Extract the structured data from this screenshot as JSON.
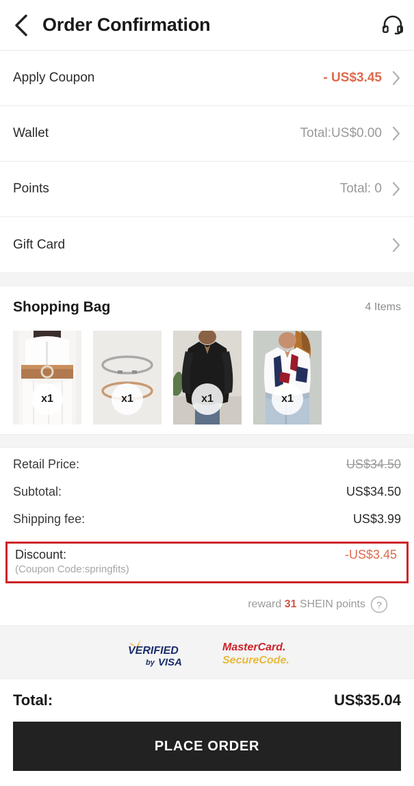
{
  "header": {
    "title": "Order Confirmation",
    "back_icon": "chevron-left-icon",
    "support_icon": "headset-icon"
  },
  "options": [
    {
      "label": "Apply Coupon",
      "value": "- US$3.45",
      "accent": true,
      "chevron": "chevron-right-icon"
    },
    {
      "label": "Wallet",
      "value": "Total:US$0.00",
      "accent": false,
      "chevron": "chevron-right-icon"
    },
    {
      "label": "Points",
      "value": "Total: 0",
      "accent": false,
      "chevron": "chevron-right-icon"
    },
    {
      "label": "Gift Card",
      "value": "",
      "accent": false,
      "chevron": "chevron-right-icon"
    }
  ],
  "shopping_bag": {
    "title": "Shopping Bag",
    "item_count": "4 Items",
    "items": [
      {
        "qty": "x1",
        "alt": "white-shirt-dress-with-brown-belt"
      },
      {
        "qty": "x1",
        "alt": "thin-skinny-belts-grey-and-tan"
      },
      {
        "qty": "x1",
        "alt": "black-long-sleeve-high-low-top"
      },
      {
        "qty": "x1",
        "alt": "white-printed-short-sleeve-blouse"
      }
    ]
  },
  "summary": {
    "retail_price_label": "Retail Price:",
    "retail_price_value": "US$34.50",
    "subtotal_label": "Subtotal:",
    "subtotal_value": "US$34.50",
    "shipping_label": "Shipping fee:",
    "shipping_value": "US$3.99",
    "discount_label": "Discount:",
    "discount_value": "-US$3.45",
    "coupon_note": "(Coupon Code:springfits)",
    "reward_prefix": "reward",
    "reward_points": "31",
    "reward_suffix": "SHEIN points",
    "help_icon": "question-mark-circle-icon"
  },
  "payment_badges": [
    {
      "name": "verified-by-visa",
      "line1": "VERIFIED",
      "line2_small": "by",
      "line2": "VISA"
    },
    {
      "name": "mastercard-securecode",
      "line1": "MasterCard",
      "line2": "SecureCode"
    }
  ],
  "total": {
    "label": "Total:",
    "value": "US$35.04"
  },
  "cta": {
    "label": "PLACE ORDER"
  },
  "colors": {
    "accent_orange": "#dd6a4d",
    "highlight_red": "#cc2229",
    "cta_bg": "#222222",
    "band_gray": "#f4f4f4",
    "muted_text": "#9a9a9a"
  }
}
